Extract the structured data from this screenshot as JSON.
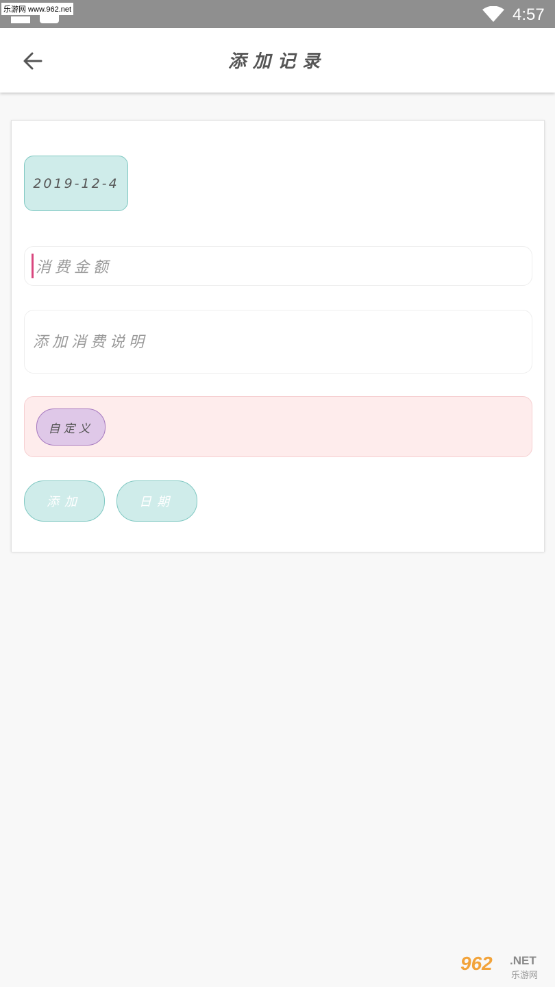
{
  "status_bar": {
    "watermark": "乐游网 www.962.net",
    "time": "4:57"
  },
  "app_bar": {
    "title": "添加记录",
    "back_icon": "arrow-left-icon"
  },
  "form": {
    "date_value": "2019-12-4",
    "amount_placeholder": "消费金额",
    "description_placeholder": "添加消费说明",
    "tags": [
      "自定义"
    ],
    "add_button": "添加",
    "date_button": "日期"
  },
  "colors": {
    "teal_chip": "#cfecea",
    "teal_border": "#7fc8c2",
    "pink_box": "#feecec",
    "purple_tag": "#dfc8e8",
    "cursor": "#d9477e"
  },
  "bottom_watermark": {
    "brand": "962",
    "domain": ".NET",
    "name": "乐游网"
  }
}
